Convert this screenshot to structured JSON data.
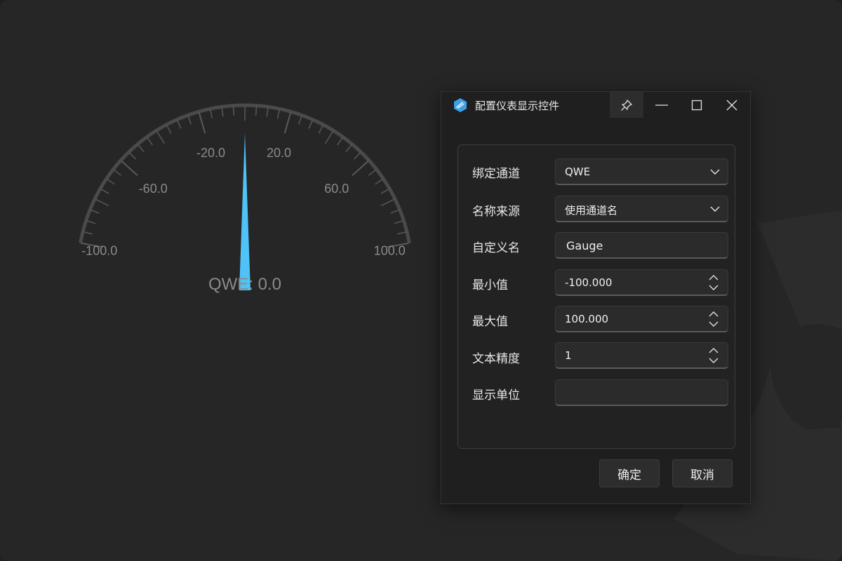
{
  "gauge": {
    "min": -100.0,
    "max": 100.0,
    "value": 0.0,
    "major_tick_labels": [
      "-100.0",
      "-60.0",
      "-20.0",
      "20.0",
      "60.0",
      "100.0"
    ],
    "readout": "QWE: 0.0",
    "needle_color": "#4fc3f7",
    "arc_color": "#4a4a4a",
    "label_color": "#8a8a8a"
  },
  "dialog": {
    "title": "配置仪表显示控件",
    "app_icon": "app-hexagon-icon",
    "title_buttons": [
      "pin-icon",
      "minimize-icon",
      "maximize-icon",
      "close-icon"
    ],
    "fields": {
      "channel": {
        "label": "绑定通道",
        "value": "QWE"
      },
      "name_source": {
        "label": "名称来源",
        "value": "使用通道名"
      },
      "custom_name": {
        "label": "自定义名",
        "value": "Gauge"
      },
      "min_value": {
        "label": "最小值",
        "value": "-100.000"
      },
      "max_value": {
        "label": "最大值",
        "value": "100.000"
      },
      "precision": {
        "label": "文本精度",
        "value": "1"
      },
      "unit": {
        "label": "显示单位",
        "value": ""
      }
    },
    "ok_label": "确定",
    "cancel_label": "取消"
  },
  "colors": {
    "background": "#262626",
    "dialog_background": "#1f1f1f",
    "accent": "#4fc3f7"
  }
}
